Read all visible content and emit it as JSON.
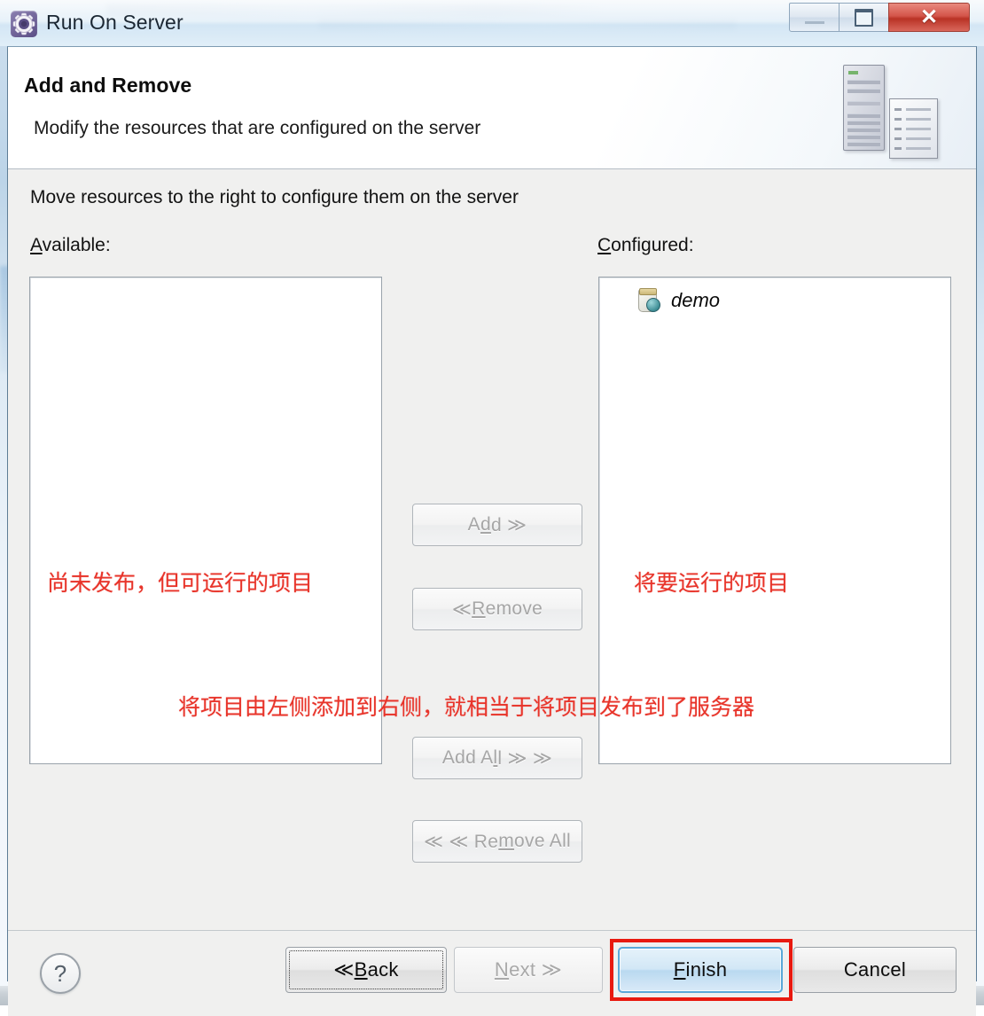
{
  "window": {
    "title": "Run On Server",
    "icon": "run-on-server-gear-icon",
    "controls": {
      "minimize_label": "–",
      "maximize_label": "□",
      "close_label": "✕"
    }
  },
  "header": {
    "title": "Add and Remove",
    "description": "Modify the resources that are configured on the server",
    "graphic": "server-and-document-icon"
  },
  "content": {
    "instruction": "Move resources to the right to configure them on the server",
    "available": {
      "label_prefix": "",
      "label_mnemonic": "A",
      "label_suffix": "vailable:",
      "items": []
    },
    "configured": {
      "label_prefix": "",
      "label_mnemonic": "C",
      "label_suffix": "onfigured:",
      "items": [
        {
          "name": "demo",
          "icon": "web-module-icon"
        }
      ]
    },
    "transfer_buttons": [
      {
        "id": "add",
        "pre": "A",
        "mnemonic": "d",
        "post": "d  ≫",
        "enabled": false
      },
      {
        "id": "remove",
        "pre": "≪  ",
        "mnemonic": "R",
        "post": "emove",
        "enabled": false
      },
      {
        "id": "add-all",
        "pre": "Add A",
        "mnemonic": "l",
        "post": "l  ≫ ≫",
        "enabled": false
      },
      {
        "id": "remove-all",
        "pre": "≪ ≪  Re",
        "mnemonic": "m",
        "post": "ove All",
        "enabled": false
      }
    ]
  },
  "annotations": {
    "left": "尚未发布，但可运行的项目",
    "right": "将要运行的项目",
    "middle": "将项目由左侧添加到右侧，就相当于将项目发布到了服务器",
    "color": "#e8342a",
    "highlight_target": "Finish"
  },
  "footer": {
    "help_label": "?",
    "buttons": {
      "back": {
        "pre": "≪  ",
        "mnemonic": "B",
        "post": "ack",
        "enabled": true,
        "focused": true
      },
      "next": {
        "pre": "",
        "mnemonic": "N",
        "post": "ext  ≫",
        "enabled": false
      },
      "finish": {
        "pre": "",
        "mnemonic": "F",
        "post": "inish",
        "enabled": true,
        "default": true
      },
      "cancel": {
        "pre": "",
        "mnemonic": "",
        "post": "Cancel",
        "enabled": true
      }
    }
  }
}
